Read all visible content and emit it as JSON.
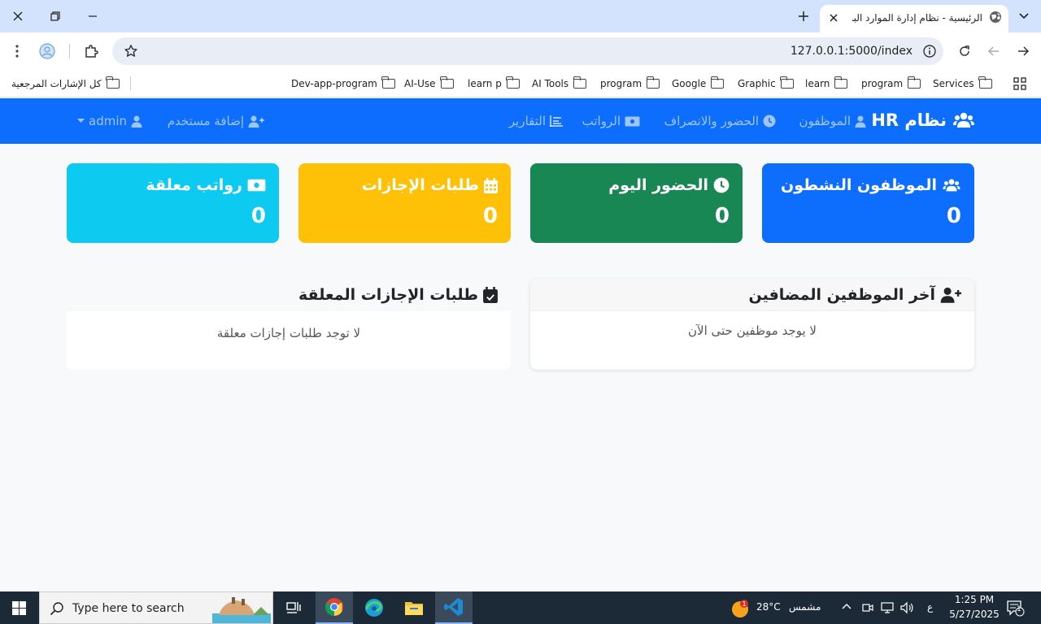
{
  "browser": {
    "tab_title": "الرئيسية - نظام إدارة الموارد البشرية",
    "url": "127.0.0.1:5000/index",
    "bookmarks": [
      {
        "label": "Services"
      },
      {
        "label": "program"
      },
      {
        "label": "learn"
      },
      {
        "label": "Graphic"
      },
      {
        "label": "Google"
      },
      {
        "label": "program"
      },
      {
        "label": "AI Tools"
      },
      {
        "label": "learn p"
      },
      {
        "label": "AI-Use"
      },
      {
        "label": "Dev-app-program"
      }
    ],
    "all_bookmarks": "كل الإشارات المرجعية"
  },
  "navbar": {
    "brand": "نظام HR",
    "items": [
      {
        "label": "الموظفون"
      },
      {
        "label": "الحضور والانصراف"
      },
      {
        "label": "الرواتب"
      },
      {
        "label": "التقارير"
      }
    ],
    "add_user": "إضافة مستخدم",
    "user": "admin"
  },
  "stats": [
    {
      "title": "الموظفون النشطون",
      "value": "0",
      "color": "#0d6efd"
    },
    {
      "title": "الحضور اليوم",
      "value": "0",
      "color": "#198754"
    },
    {
      "title": "طلبات الإجازات",
      "value": "0",
      "color": "#ffc107"
    },
    {
      "title": "رواتب معلقة",
      "value": "0",
      "color": "#0dcaf0"
    }
  ],
  "panels": {
    "recent_employees": {
      "title": "آخر الموظفين المضافين",
      "empty": "لا يوجد موظفين حتى الآن"
    },
    "pending_leaves": {
      "title": "طلبات الإجازات المعلقة",
      "empty": "لا توجد طلبات إجازات معلقة"
    }
  },
  "taskbar": {
    "search_placeholder": "Type here to search",
    "weather_temp": "28°C",
    "weather_desc": "مشمس",
    "weather_badge": "1",
    "lang": "ع",
    "time": "1:25 PM",
    "date": "5/27/2025",
    "notif_count": "1"
  },
  "colors": {
    "primary": "#0d6efd",
    "success": "#198754",
    "warning": "#ffc107",
    "info": "#0dcaf0"
  }
}
